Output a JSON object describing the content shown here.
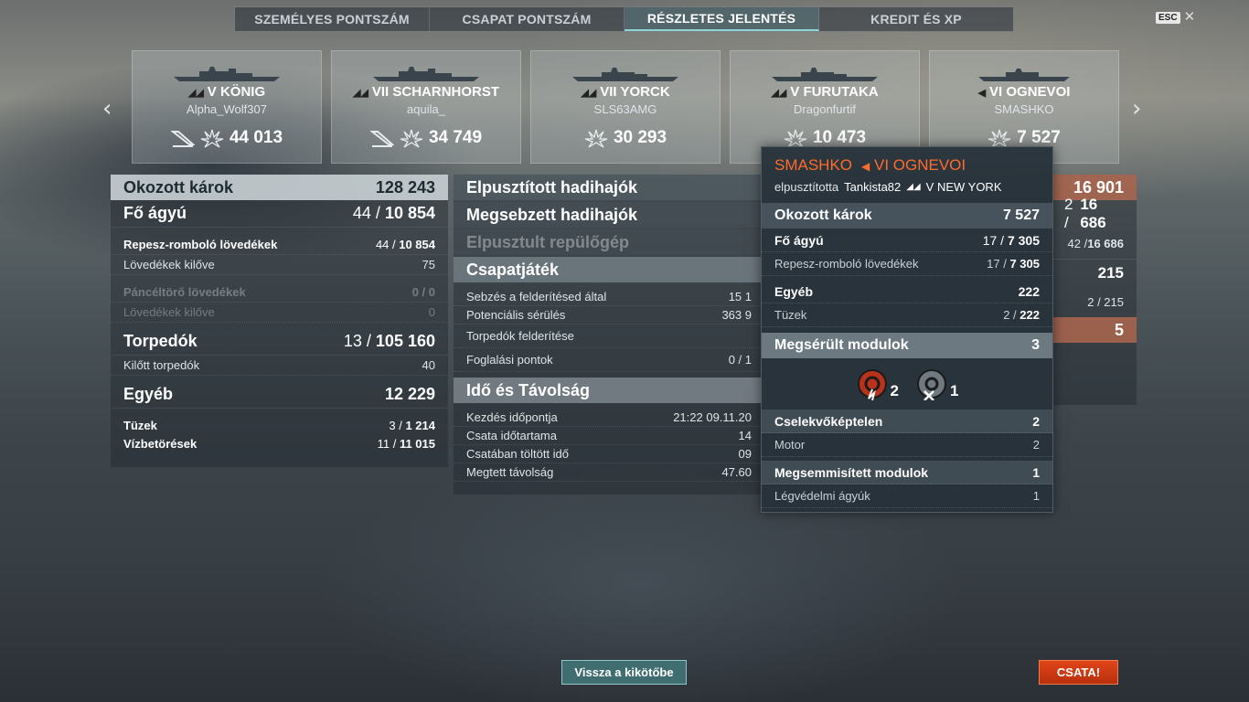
{
  "tabs": [
    "SZEMÉLYES PONTSZÁM",
    "CSAPAT PONTSZÁM",
    "RÉSZLETES JELENTÉS",
    "KREDIT ÉS XP"
  ],
  "esc_label": "ESC",
  "cards": [
    {
      "ship": "V KÖNIG",
      "player": "Alpha_Wolf307",
      "score": "44 013"
    },
    {
      "ship": "VII SCHARNHORST",
      "player": "aquila_",
      "score": "34 749"
    },
    {
      "ship": "VII YORCK",
      "player": "SLS63AMG",
      "score": "30 293"
    },
    {
      "ship": "V FURUTAKA",
      "player": "Dragonfurtif",
      "score": "10 473"
    },
    {
      "ship": "VI OGNEVOI",
      "player": "SMASHKO",
      "score": "7 527"
    }
  ],
  "left": {
    "damage_label": "Okozott károk",
    "damage_value": "128 243",
    "main_label": "Fő ágyú",
    "main_hits": "44 / ",
    "main_value": "10 854",
    "he_label": "Repesz-romboló lövedékek",
    "he_hits": "44 / ",
    "he_value": "10 854",
    "he_fired_label": "Lövedékek kilőve",
    "he_fired": "75",
    "ap_label": "Páncéltörő lövedékek",
    "ap_value": "0 / 0",
    "ap_fired_label": "Lövedékek kilőve",
    "ap_fired": "0",
    "torp_label": "Torpedók",
    "torp_hits": "13 / ",
    "torp_value": "105 160",
    "torp_fired_label": "Kilőtt torpedók",
    "torp_fired": "40",
    "other_label": "Egyéb",
    "other_value": "12 229",
    "fire_label": "Tüzek",
    "fire_hits": "3 / ",
    "fire_value": "1 214",
    "flood_label": "Vízbetörések",
    "flood_hits": "11 / ",
    "flood_value": "11 015"
  },
  "middle": {
    "destroyed_label": "Elpusztított hadihajók",
    "damaged_label": "Megsebzett hadihajók",
    "planes_label": "Elpusztult repülőgép",
    "team_label": "Csapatjáték",
    "spotting_label": "Sebzés a felderítésed által",
    "spotting_value": "15 1",
    "potential_label": "Potenciális sérülés",
    "potential_value": "363 9",
    "torp_spot_label": "Torpedók felderítése",
    "capture_label": "Foglalási pontok",
    "capture_value": "0 / 1",
    "time_label": "Idő és Távolság",
    "start_label": "Kezdés időpontja",
    "start_value": "21:22  09.11.20",
    "duration_label": "Csata időtartama",
    "duration_value": "14",
    "ingame_label": "Csatában töltött idő",
    "ingame_value": "09",
    "distance_label": "Megtett távolság",
    "distance_value": "47.60"
  },
  "right": {
    "damage_value": "16 901",
    "main_value_prefix": "2 / ",
    "main_value": "16 686",
    "he_value_prefix": "42 / ",
    "he_value": "16 686",
    "other_value": "215",
    "fire_value": "2 / 215",
    "modules_value": "5"
  },
  "tooltip": {
    "player": "SMASHKO",
    "ship": "VI OGNEVOI",
    "destroyed_by_label": "elpusztította",
    "killer": "Tankista82",
    "killer_ship": "V NEW YORK",
    "damage_label": "Okozott károk",
    "damage_value": "7 527",
    "main_label": "Fő ágyú",
    "main_hits": "17 / ",
    "main_value": "7 305",
    "he_label": "Repesz-romboló lövedékek",
    "he_hits": "17 / ",
    "he_value": "7 305",
    "other_label": "Egyéb",
    "other_value": "222",
    "fire_label": "Tüzek",
    "fire_hits": "2 / ",
    "fire_value": "222",
    "damaged_mod_label": "Megsérült modulok",
    "damaged_mod_value": "3",
    "mod1_count": "2",
    "mod2_count": "1",
    "incap_label": "Cselekvőképtelen",
    "incap_value": "2",
    "engine_label": "Motor",
    "engine_value": "2",
    "destroyed_mod_label": "Megsemmisített modulok",
    "destroyed_mod_value": "1",
    "aa_label": "Légvédelmi ágyúk",
    "aa_value": "1"
  },
  "buttons": {
    "back": "Vissza a kikötőbe",
    "battle": "CSATA!"
  },
  "colors": {
    "accent_orange": "#ff6b2b",
    "battle_red": "#d63a12",
    "back_teal": "#3f6d70"
  }
}
